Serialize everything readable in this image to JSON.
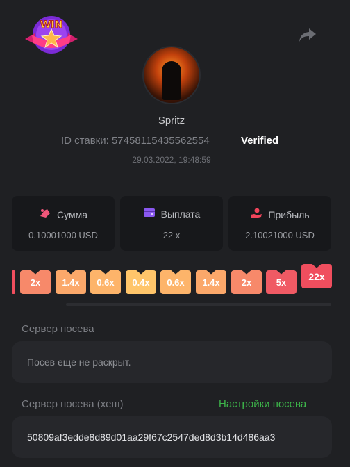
{
  "header": {
    "logo_text": "WIN",
    "share_icon": "share-icon"
  },
  "user": {
    "name": "Spritz",
    "bet_id_label": "ID ставки:",
    "bet_id": "57458115435562554",
    "verified": "Verified",
    "date": "29.03.2022, 19:48:59"
  },
  "stats": {
    "sum_label": "Сумма",
    "sum_value": "0.10001000 USD",
    "payout_label": "Выплата",
    "payout_value": "22 x",
    "profit_label": "Прибыль",
    "profit_value": "2.10021000 USD"
  },
  "multipliers": [
    "2x",
    "1.4x",
    "0.6x",
    "0.4x",
    "0.6x",
    "1.4x",
    "2x",
    "5x",
    "22x"
  ],
  "colors": {
    "red": "#f04e5e",
    "orange": "#f7896a",
    "amber": "#fba86a",
    "yellow": "#ffc56a",
    "green": "#3db64a"
  },
  "seed": {
    "server_label": "Сервер посева",
    "server_value": "Посев еще не раскрыт.",
    "hash_label": "Сервер посева (хеш)",
    "settings_link": "Настройки посева",
    "hash_value": "50809af3edde8d89d01aa29f67c2547ded8d3b14d486aa3"
  }
}
